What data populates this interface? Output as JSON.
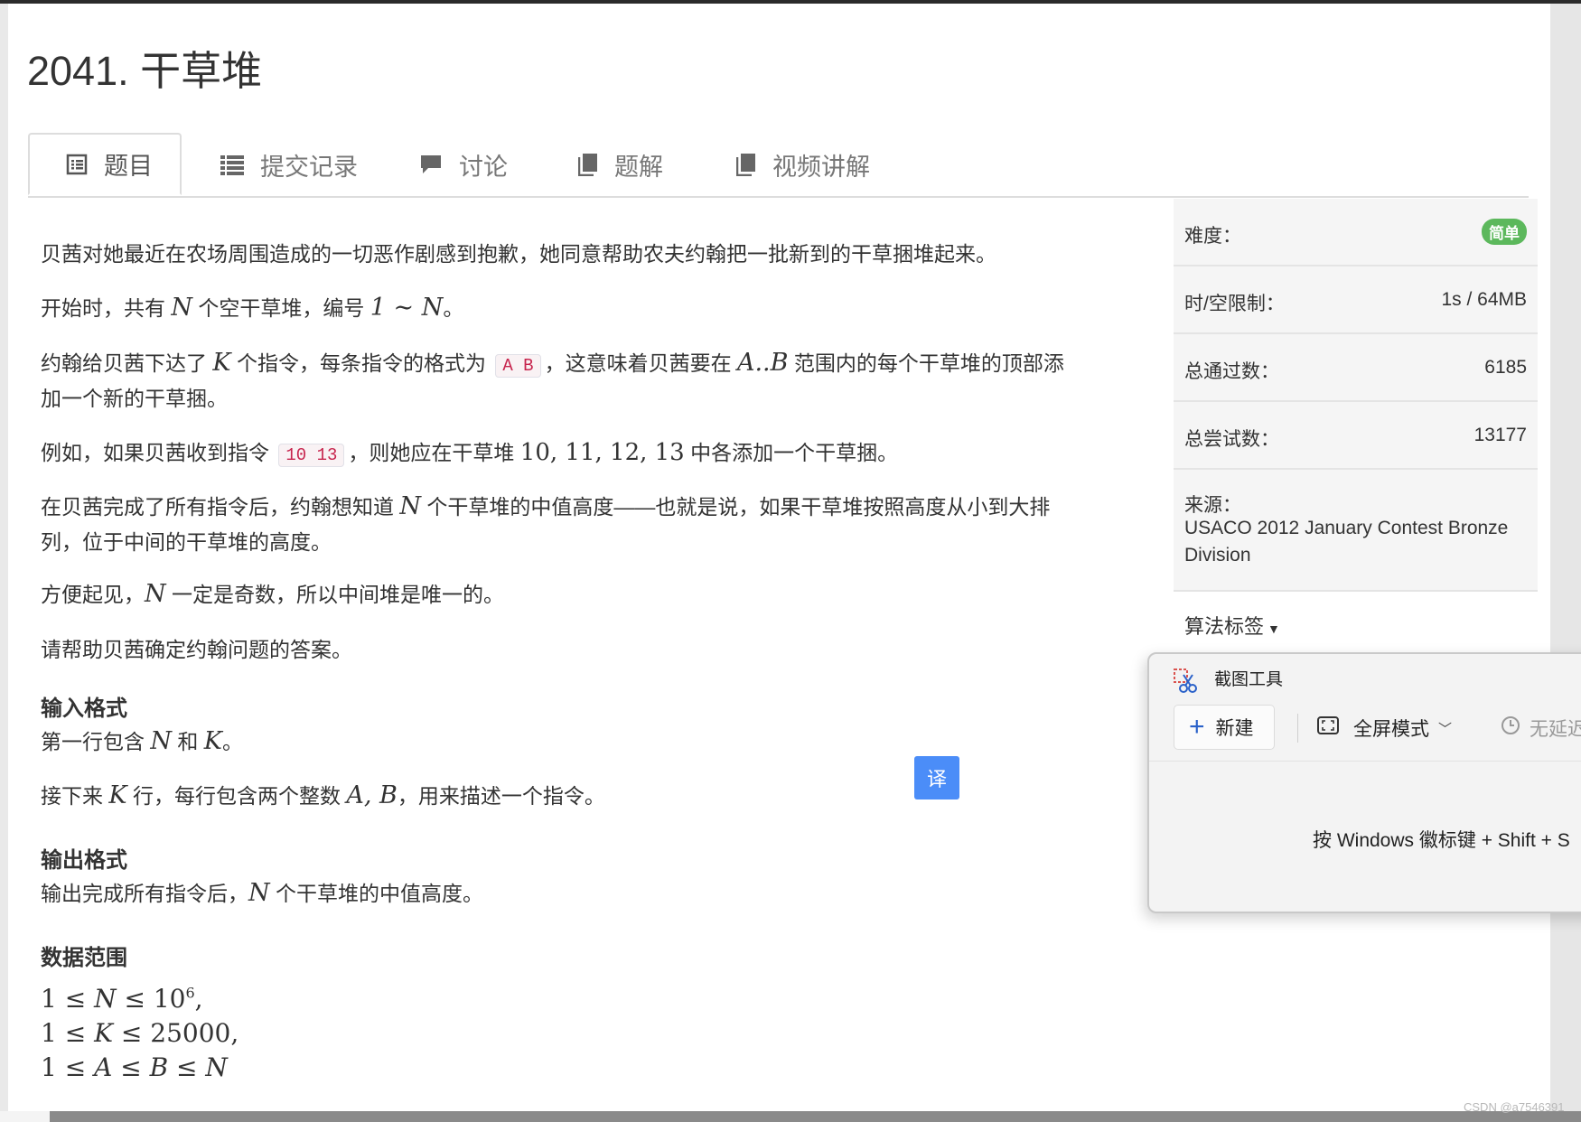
{
  "problem": {
    "title": "2041. 干草堆"
  },
  "tabs": [
    {
      "label": "题目",
      "icon": "list-alt-icon",
      "active": true
    },
    {
      "label": "提交记录",
      "icon": "list-icon"
    },
    {
      "label": "讨论",
      "icon": "comment-icon"
    },
    {
      "label": "题解",
      "icon": "book-icon"
    },
    {
      "label": "视频讲解",
      "icon": "book-icon"
    }
  ],
  "description": {
    "p1": "贝茜对她最近在农场周围造成的一切恶作剧感到抱歉，她同意帮助农夫约翰把一批新到的干草捆堆起来。",
    "p2": {
      "a": "开始时，共有 ",
      "m1": "N",
      "b": " 个空干草堆，编号 ",
      "m2": "1 ∼ N",
      "c": "。"
    },
    "p3": {
      "a": "约翰给贝茜下达了 ",
      "m1": "K",
      "b": " 个指令，每条指令的格式为 ",
      "code": "A B",
      "c": "，这意味着贝茜要在 ",
      "m2": "A..B",
      "d": " 范围内的每个干草堆的顶部添",
      "line2": "加一个新的干草捆。"
    },
    "p4": {
      "a": "例如，如果贝茜收到指令 ",
      "code": "10 13",
      "b": "，则她应在干草堆 ",
      "m1": "10, 11, 12, 13",
      "c": " 中各添加一个干草捆。"
    },
    "p5": {
      "a": "在贝茜完成了所有指令后，约翰想知道 ",
      "m1": "N",
      "b": " 个干草堆的中值高度——也就是说，如果干草堆按照高度从小到大排",
      "line2": "列，位于中间的干草堆的高度。"
    },
    "p6": {
      "m1": "N",
      "a": " 一定是奇数，所以中间堆是唯一的。",
      "prefix": "方便起见，"
    },
    "p7": "请帮助贝茜确定约翰问题的答案。"
  },
  "input_format": {
    "heading": "输入格式",
    "line1": {
      "a": "第一行包含 ",
      "m1": "N",
      "b": " 和 ",
      "m2": "K",
      "c": "。"
    },
    "line2": {
      "a": "接下来 ",
      "m1": "K",
      "b": " 行，每行包含两个整数 ",
      "m2": "A, B",
      "c": "，用来描述一个指令。"
    }
  },
  "output_format": {
    "heading": "输出格式",
    "line1": {
      "a": "输出完成所有指令后，",
      "m1": "N",
      "b": " 个干草堆的中值高度。"
    }
  },
  "constraints": {
    "heading": "数据范围",
    "c1": {
      "pre": "1 ≤ ",
      "v": "N",
      "mid": " ≤ 10",
      "sup": "6",
      "post": ","
    },
    "c2": {
      "pre": "1 ≤ ",
      "v": "K",
      "mid": " ≤ 25000",
      "post": ","
    },
    "c3": {
      "pre": "1 ≤ ",
      "v1": "A",
      "mid": " ≤ ",
      "v2": "B",
      "mid2": " ≤ ",
      "v3": "N"
    }
  },
  "translate_button": "译",
  "sidebar": {
    "difficulty_label": "难度：",
    "difficulty_value": "简单",
    "difficulty_color": "#5cb85c",
    "limit_label": "时/空限制：",
    "limit_value": "1s / 64MB",
    "accepted_label": "总通过数：",
    "accepted_value": "6185",
    "attempts_label": "总尝试数：",
    "attempts_value": "13177",
    "source_label": "来源：",
    "source_line1": "USACO 2012 January Contest Bronze",
    "source_line2": "Division",
    "tags_label": "算法标签"
  },
  "snipping_tool": {
    "title": "截图工具",
    "new_label": "新建",
    "mode_label": "全屏模式",
    "delay_label": "无延迟",
    "hint": "按 Windows 徽标键 + Shift + S"
  },
  "watermark": "CSDN @a7546391"
}
